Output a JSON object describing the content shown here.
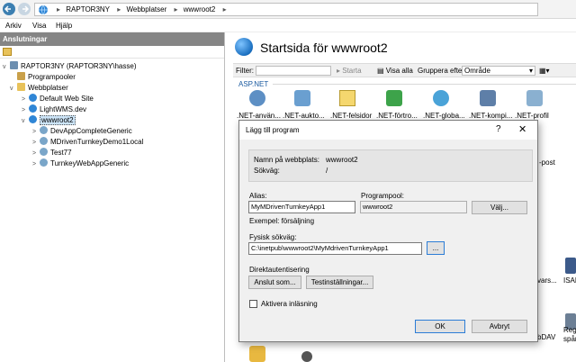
{
  "address_bar": {
    "crumbs": [
      "RAPTOR3NY",
      "Webbplatser",
      "wwwroot2"
    ]
  },
  "menu": [
    "Arkiv",
    "Visa",
    "Hjälp"
  ],
  "left_pane": {
    "header": "Anslutningar",
    "tree": [
      {
        "label": "RAPTOR3NY (RAPTOR3NY\\hasse)",
        "level": 0,
        "chev": "v"
      },
      {
        "label": "Programpooler",
        "level": 1,
        "chev": ""
      },
      {
        "label": "Webbplatser",
        "level": 1,
        "chev": "v"
      },
      {
        "label": "Default Web Site",
        "level": 2,
        "chev": ">"
      },
      {
        "label": "LightWMS.dev",
        "level": 2,
        "chev": ">"
      },
      {
        "label": "wwwroot2",
        "level": 2,
        "chev": "v",
        "selected": true
      },
      {
        "label": "DevAppCompleteGeneric",
        "level": 3,
        "chev": ">"
      },
      {
        "label": "MDrivenTurnkeyDemo1Local",
        "level": 3,
        "chev": ">"
      },
      {
        "label": "Test77",
        "level": 3,
        "chev": ">"
      },
      {
        "label": "TurnkeyWebAppGeneric",
        "level": 3,
        "chev": ">"
      }
    ]
  },
  "right_pane": {
    "title": "Startsida för wwwroot2",
    "filter_label": "Filter:",
    "start_label": "Starta",
    "show_all_label": "Visa alla",
    "group_by_label": "Gruppera efter:",
    "group_by_value": "Område",
    "section": "ASP.NET",
    "features": [
      ".NET-använ...",
      ".NET-aukto...",
      ".NET-felsidor",
      ".NET-förtro...",
      ".NET-globa...",
      ".NET-kompi...",
      ".NET-profil"
    ],
    "partial_labels": [
      "-post",
      "vars...",
      "ISAP",
      "bDAV",
      "Reg",
      "spårn"
    ]
  },
  "dialog": {
    "title": "Lägg till program",
    "help": "?",
    "close": "✕",
    "site_name_label": "Namn på webbplats:",
    "site_name_value": "wwwroot2",
    "path_label": "Sökväg:",
    "path_value": "/",
    "alias_label": "Alias:",
    "alias_value": "MyMDrivenTurnkeyApp1",
    "pool_label": "Programpool:",
    "pool_value": "wwwroot2",
    "select_button": "Välj...",
    "example": "Exempel: försäljning",
    "physical_path_label": "Fysisk sökväg:",
    "physical_path_value": "C:\\inetpub\\wwwroot2\\MyMdrivenTurnkeyApp1",
    "browse_button": "...",
    "pass_through_label": "Direktautentisering",
    "connect_as_button": "Anslut som...",
    "test_settings_button": "Testinställningar...",
    "enable_preload_label": "Aktivera inläsning",
    "ok_button": "OK",
    "cancel_button": "Avbryt"
  },
  "colors": {
    "tree_selected": "#cce4f7",
    "left_header_bg": "#858585",
    "section_text": "#1a5aa0",
    "default_button_border": "#2c7dd6"
  }
}
